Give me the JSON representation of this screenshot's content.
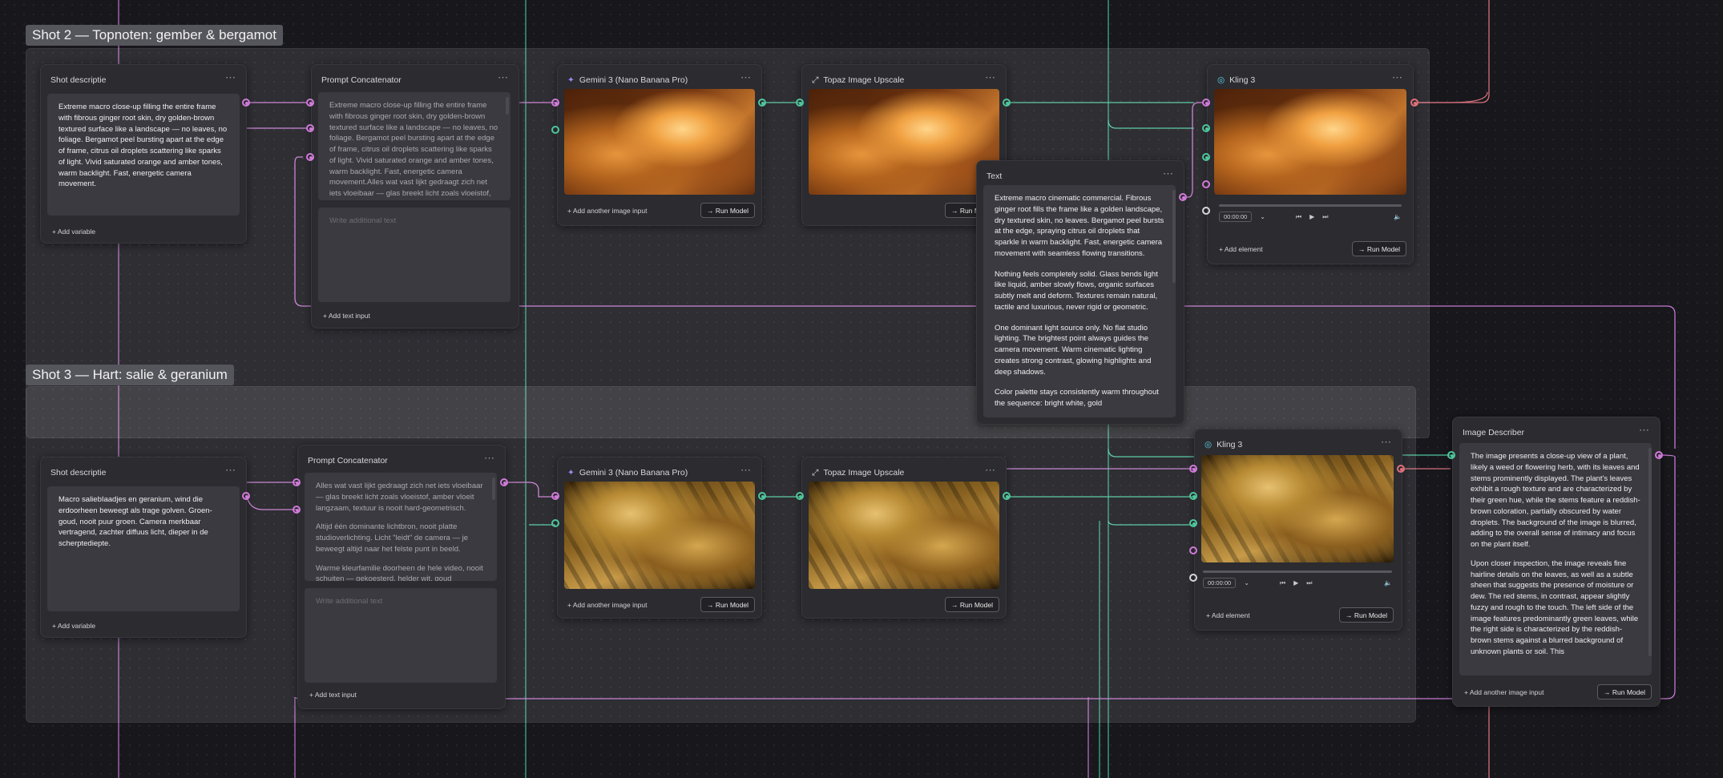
{
  "groups": [
    {
      "title": "Shot 2 — Topnoten: gember & bergamot"
    },
    {
      "title": "Shot 3 — Hart: salie & geranium"
    }
  ],
  "shot2": {
    "descript": {
      "title": "Shot descriptie",
      "text": "Extreme macro close-up filling the entire frame with fibrous ginger root skin, dry golden-brown textured surface like a landscape — no leaves, no foliage. Bergamot peel bursting apart at the edge of frame, citrus oil droplets scattering like sparks of light. Vivid saturated orange and amber tones, warm backlight. Fast, energetic camera movement.",
      "add_variable": "Add variable"
    },
    "concat": {
      "title": "Prompt Concatenator",
      "text": "Extreme macro close-up filling the entire frame with fibrous ginger root skin, dry golden-brown textured surface like a landscape — no leaves, no foliage. Bergamot peel bursting apart at the edge of frame, citrus oil droplets scattering like sparks of light. Vivid saturated orange and amber tones, warm backlight. Fast, energetic camera movement.Alles wat vast lijkt gedraagt zich net iets vloeibaar — glas breekt licht zoals vloeistof, amber vloeit langzaam, textuur is nooit",
      "placeholder": "Write additional text",
      "add_text_input": "Add text input"
    },
    "gemini": {
      "title": "Gemini 3 (Nano Banana Pro)",
      "add_image": "Add another image input",
      "run": "Run Model"
    },
    "topaz": {
      "title": "Topaz Image Upscale",
      "run": "Run Model"
    },
    "kling": {
      "title": "Kling 3",
      "time": "00:00:00",
      "add_element": "Add element",
      "run": "Run Model"
    }
  },
  "text_node": {
    "title": "Text",
    "paragraphs": [
      "Extreme macro cinematic commercial. Fibrous ginger root fills the frame like a golden landscape, dry textured skin, no leaves. Bergamot peel bursts at the edge, spraying citrus oil droplets that sparkle in warm backlight. Fast, energetic camera movement with seamless flowing transitions.",
      "Nothing feels completely solid. Glass bends light like liquid, amber slowly flows, organic surfaces subtly melt and deform. Textures remain natural, tactile and luxurious, never rigid or geometric.",
      "One dominant light source only. No flat studio lighting. The brightest point always guides the camera movement. Warm cinematic lighting creates strong contrast, glowing highlights and deep shadows.",
      "Color palette stays consistently warm throughout the sequence: bright white, gold"
    ]
  },
  "shot3": {
    "descript": {
      "title": "Shot descriptie",
      "text": "Macro saliebIaadjes en geranium, wind die erdoorheen beweegt als trage golven. Groen-goud, nooit puur groen. Camera merkbaar vertragend, zachter diffuus licht, dieper in de scherptediepte.",
      "add_variable": "Add variable"
    },
    "concat": {
      "title": "Prompt Concatenator",
      "text1": "Alles wat vast lijkt gedraagt zich net iets vloeibaar — glas breekt licht zoals vloeistof, amber vloeit langzaam, textuur is nooit hard-geometrisch.",
      "text2": "Altijd één dominante lichtbron, nooit platte studioverlichting. Licht \"leidt\" de camera — je beweegt altijd naar het felste punt in beeld.",
      "text3": "Warme kleurfamilie doorheen de hele video, nooit schuiten — gekoesterd, helder wit, goud",
      "placeholder": "Write additional text",
      "add_text_input": "Add text input"
    },
    "gemini": {
      "title": "Gemini 3 (Nano Banana Pro)",
      "add_image": "Add another image input",
      "run": "Run Model"
    },
    "topaz": {
      "title": "Topaz Image Upscale",
      "run": "Run Model"
    },
    "kling": {
      "title": "Kling 3",
      "time": "00:00:00",
      "add_element": "Add element",
      "run": "Run Model"
    }
  },
  "describer": {
    "title": "Image Describer",
    "p1": "The image presents a close-up view of a plant, likely a weed or flowering herb, with its leaves and stems prominently displayed. The plant's leaves exhibit a rough texture and are characterized by their green hue, while the stems feature a reddish-brown coloration, partially obscured by water droplets. The background of the image is blurred, adding to the overall sense of intimacy and focus on the plant itself.",
    "p2": "Upon closer inspection, the image reveals fine hairline details on the leaves, as well as a subtle sheen that suggests the presence of moisture or dew. The red stems, in contrast, appear slightly fuzzy and rough to the touch. The left side of the image features predominantly green leaves, while the right side is characterized by the reddish-brown stems against a blurred background of unknown plants or soil. This",
    "add_image": "Add another image input",
    "run": "Run Model"
  },
  "icons": {
    "menu": "⋯",
    "plus": "+",
    "arrow": "→",
    "play": "▶",
    "prev": "⏮",
    "next": "⏭",
    "volume": "🔈",
    "chevron": "⌄"
  },
  "colors": {
    "wire_pink": "#c77ad1",
    "wire_green": "#4ec79b",
    "wire_red": "#e0707a"
  }
}
